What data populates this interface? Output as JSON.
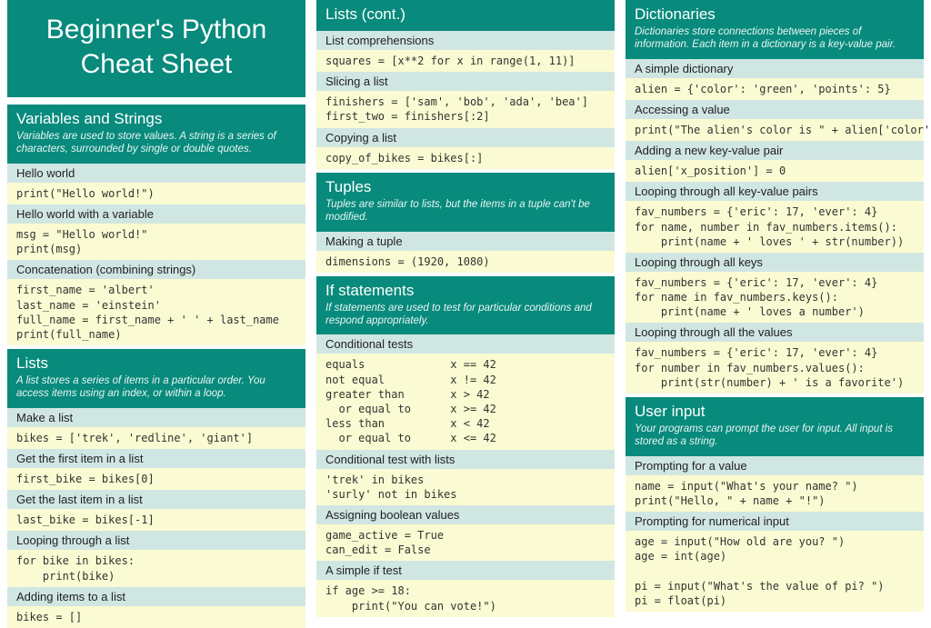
{
  "title_line1": "Beginner's Python",
  "title_line2": "Cheat Sheet",
  "col1": {
    "sec1": {
      "title": "Variables and Strings",
      "desc": "Variables are used to store values. A string is a series of characters, surrounded by single or double quotes.",
      "items": [
        {
          "sub": "Hello world",
          "code": "print(\"Hello world!\")"
        },
        {
          "sub": "Hello world with a variable",
          "code": "msg = \"Hello world!\"\nprint(msg)"
        },
        {
          "sub": "Concatenation (combining strings)",
          "code": "first_name = 'albert'\nlast_name = 'einstein'\nfull_name = first_name + ' ' + last_name\nprint(full_name)"
        }
      ]
    },
    "sec2": {
      "title": "Lists",
      "desc": "A list stores a series of items in a particular order. You access items using an index, or within a loop.",
      "items": [
        {
          "sub": "Make a list",
          "code": "bikes = ['trek', 'redline', 'giant']"
        },
        {
          "sub": "Get the first item in a list",
          "code": "first_bike = bikes[0]"
        },
        {
          "sub": "Get the last item in a list",
          "code": "last_bike = bikes[-1]"
        },
        {
          "sub": "Looping through a list",
          "code": "for bike in bikes:\n    print(bike)"
        },
        {
          "sub": "Adding items to a list",
          "code": "bikes = []"
        }
      ]
    }
  },
  "col2": {
    "sec1": {
      "title": "Lists (cont.)",
      "desc": "",
      "items": [
        {
          "sub": "List comprehensions",
          "code": "squares = [x**2 for x in range(1, 11)]"
        },
        {
          "sub": "Slicing a list",
          "code": "finishers = ['sam', 'bob', 'ada', 'bea']\nfirst_two = finishers[:2]"
        },
        {
          "sub": "Copying a list",
          "code": "copy_of_bikes = bikes[:]"
        }
      ]
    },
    "sec2": {
      "title": "Tuples",
      "desc": "Tuples are similar to lists, but the items in a tuple can't be modified.",
      "items": [
        {
          "sub": "Making a tuple",
          "code": "dimensions = (1920, 1080)"
        }
      ]
    },
    "sec3": {
      "title": "If statements",
      "desc": "If statements are used to test for particular conditions and respond appropriately.",
      "items": [
        {
          "sub": "Conditional tests",
          "code": "equals             x == 42\nnot equal          x != 42\ngreater than       x > 42\n  or equal to      x >= 42\nless than          x < 42\n  or equal to      x <= 42"
        },
        {
          "sub": "Conditional test with lists",
          "code": "'trek' in bikes\n'surly' not in bikes"
        },
        {
          "sub": "Assigning boolean values",
          "code": "game_active = True\ncan_edit = False"
        },
        {
          "sub": "A simple if test",
          "code": "if age >= 18:\n    print(\"You can vote!\")"
        }
      ]
    }
  },
  "col3": {
    "sec1": {
      "title": "Dictionaries",
      "desc": "Dictionaries store connections between pieces of information. Each item in a dictionary is a key-value pair.",
      "items": [
        {
          "sub": "A simple dictionary",
          "code": "alien = {'color': 'green', 'points': 5}"
        },
        {
          "sub": "Accessing a value",
          "code": "print(\"The alien's color is \" + alien['color'])"
        },
        {
          "sub": "Adding a new key-value pair",
          "code": "alien['x_position'] = 0"
        },
        {
          "sub": "Looping through all key-value pairs",
          "code": "fav_numbers = {'eric': 17, 'ever': 4}\nfor name, number in fav_numbers.items():\n    print(name + ' loves ' + str(number))"
        },
        {
          "sub": "Looping through all keys",
          "code": "fav_numbers = {'eric': 17, 'ever': 4}\nfor name in fav_numbers.keys():\n    print(name + ' loves a number')"
        },
        {
          "sub": "Looping through all the values",
          "code": "fav_numbers = {'eric': 17, 'ever': 4}\nfor number in fav_numbers.values():\n    print(str(number) + ' is a favorite')"
        }
      ]
    },
    "sec2": {
      "title": "User input",
      "desc": "Your programs can prompt the user for input. All input is stored as a string.",
      "items": [
        {
          "sub": "Prompting for a value",
          "code": "name = input(\"What's your name? \")\nprint(\"Hello, \" + name + \"!\")"
        },
        {
          "sub": "Prompting for numerical input",
          "code": "age = input(\"How old are you? \")\nage = int(age)\n\npi = input(\"What's the value of pi? \")\npi = float(pi)"
        }
      ]
    }
  }
}
